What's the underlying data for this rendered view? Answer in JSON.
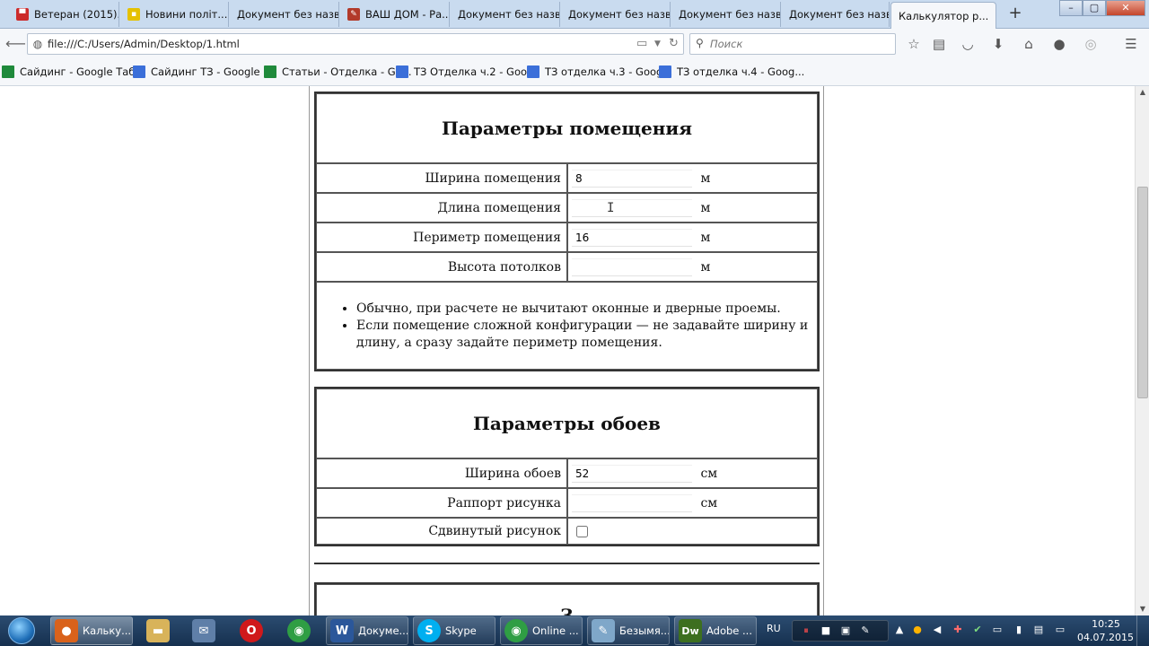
{
  "browser": {
    "tabs": [
      {
        "label": "Ветеран (2015)...",
        "icon": "flag-icon",
        "color": "#cc2b2b"
      },
      {
        "label": "Новини політ...",
        "icon": "page-icon",
        "color": "#e5c100"
      },
      {
        "label": "Документ без назв...",
        "icon": "",
        "color": ""
      },
      {
        "label": "ВАШ ДОМ - Ра...",
        "icon": "brush-icon",
        "color": "#b23a2a"
      },
      {
        "label": "Документ без назв...",
        "icon": "",
        "color": ""
      },
      {
        "label": "Документ без назв...",
        "icon": "",
        "color": ""
      },
      {
        "label": "Документ без назв...",
        "icon": "",
        "color": ""
      },
      {
        "label": "Документ без назв...",
        "icon": "",
        "color": ""
      },
      {
        "label": "Калькулятор р...",
        "icon": "",
        "color": "",
        "active": true
      }
    ],
    "new_tab_label": "+",
    "tab_close": "✕",
    "url": "file:///C:/Users/Admin/Desktop/1.html",
    "search_placeholder": "Поиск",
    "bookmarks": [
      {
        "label": "Сайдинг - Google Таб...",
        "type": "sheet"
      },
      {
        "label": "Сайдинг ТЗ - Google ...",
        "type": "doc"
      },
      {
        "label": "Статьи - Отделка - Go...",
        "type": "sheet"
      },
      {
        "label": "ТЗ Отделка ч.2 - Goo...",
        "type": "doc"
      },
      {
        "label": "ТЗ отделка ч.3 - Goog...",
        "type": "doc"
      },
      {
        "label": "ТЗ отделка ч.4 - Goog...",
        "type": "doc"
      }
    ]
  },
  "room": {
    "title": "Параметры помещения",
    "fields": [
      {
        "label": "Ширина помещения",
        "value": "8",
        "unit": "м"
      },
      {
        "label": "Длина помещения",
        "value": "",
        "unit": "м"
      },
      {
        "label": "Периметр помещения",
        "value": "16",
        "unit": "м"
      },
      {
        "label": "Высота потолков",
        "value": "",
        "unit": "м"
      }
    ],
    "notes": [
      "Обычно, при расчете не вычитают оконные и дверные проемы.",
      "Если помещение сложной конфигурации — не задавайте ширину и длину, а сразу задайте периметр помещения."
    ]
  },
  "wallpaper": {
    "title": "Параметры обоев",
    "fields": [
      {
        "label": "Ширина обоев",
        "value": "52",
        "unit": "см"
      },
      {
        "label": "Раппорт рисунка",
        "value": "",
        "unit": "см"
      }
    ],
    "shifted_label": "Сдвинутый рисунок",
    "shifted_checked": false
  },
  "next_section_partial": "З",
  "taskbar": {
    "buttons": [
      {
        "label": "Кальку...",
        "color": "#d9621b",
        "glyph": "🦊",
        "active": true
      },
      {
        "label": "",
        "color": "#d8b35a",
        "glyph": "📁"
      },
      {
        "label": "",
        "color": "#5f7fa8",
        "glyph": "✉"
      },
      {
        "label": "",
        "color": "#d0191b",
        "glyph": "O"
      },
      {
        "label": "",
        "color": "#2f9e44",
        "glyph": "◉"
      },
      {
        "label": "Докуме...",
        "color": "#2b579a",
        "glyph": "W"
      },
      {
        "label": "Skype",
        "color": "#00aff0",
        "glyph": "S"
      },
      {
        "label": "Online ...",
        "color": "#2f9e44",
        "glyph": "◉"
      },
      {
        "label": "Безымя...",
        "color": "#7fa7c9",
        "glyph": "✎"
      },
      {
        "label": "Adobe ...",
        "color": "#3d6f1f",
        "glyph": "Dw"
      }
    ],
    "lang": "RU",
    "time": "10:25",
    "date": "04.07.2015"
  }
}
